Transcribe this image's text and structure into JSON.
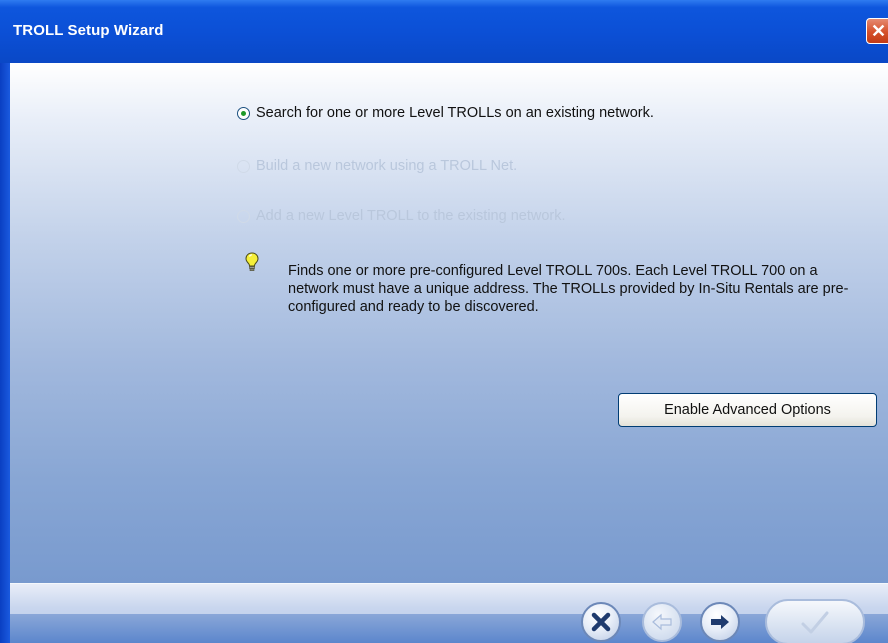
{
  "window": {
    "title": "TROLL Setup Wizard"
  },
  "options": [
    {
      "label": "Search for one or more Level TROLLs on an existing network.",
      "checked": true,
      "enabled": true
    },
    {
      "label": "Build a new network using a TROLL Net.",
      "checked": false,
      "enabled": false
    },
    {
      "label": "Add a new Level TROLL to the existing network.",
      "checked": false,
      "enabled": false
    }
  ],
  "hint": {
    "icon": "lightbulb-icon",
    "text": "Finds one or more pre-configured Level TROLL 700s. Each Level TROLL 700 on a network must have a unique address. The TROLLs provided by In-Situ Rentals are pre-configured and ready to be discovered."
  },
  "advanced_button": {
    "label": "Enable Advanced Options"
  },
  "nav": {
    "cancel_icon": "x-icon",
    "back_icon": "arrow-left-icon",
    "next_icon": "arrow-right-icon",
    "finish_icon": "checkmark-icon"
  },
  "colors": {
    "titlebar": "#0b4fd5",
    "radio_checked": "#1f9a2a",
    "disabled_text": "#b9c7dc"
  }
}
